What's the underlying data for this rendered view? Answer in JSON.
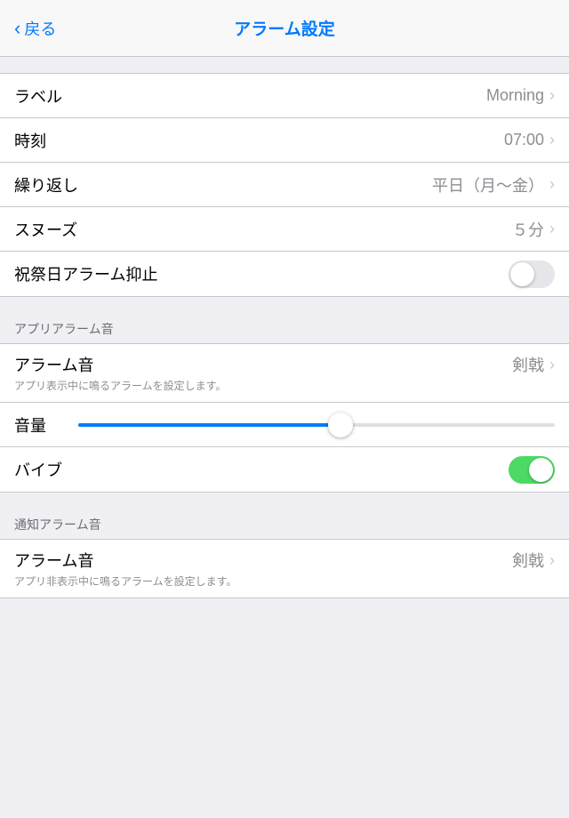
{
  "nav": {
    "back_label": "戻る",
    "title": "アラーム設定"
  },
  "sections": {
    "main": {
      "rows": [
        {
          "id": "label",
          "left": "ラベル",
          "right": "Morning",
          "has_chevron": true
        },
        {
          "id": "time",
          "left": "時刻",
          "right": "07:00",
          "has_chevron": true
        },
        {
          "id": "repeat",
          "left": "繰り返し",
          "right": "平日（月〜金）",
          "has_chevron": true
        },
        {
          "id": "snooze",
          "left": "スヌーズ",
          "right": "５分",
          "has_chevron": true
        },
        {
          "id": "holiday",
          "left": "祝祭日アラーム抑止",
          "right": null,
          "toggle": "off",
          "has_chevron": false
        }
      ]
    },
    "app_alarm": {
      "section_label": "アプリアラーム音",
      "rows": [
        {
          "id": "alarm-sound-app",
          "left": "アラーム音",
          "subtitle": "アプリ表示中に鳴るアラームを設定します。",
          "right": "剣戟",
          "has_chevron": true
        },
        {
          "id": "volume",
          "left": "音量",
          "is_slider": true,
          "fill_percent": 55
        },
        {
          "id": "vibrate",
          "left": "バイブ",
          "toggle": "on",
          "has_chevron": false
        }
      ]
    },
    "notification_alarm": {
      "section_label": "通知アラーム音",
      "rows": [
        {
          "id": "alarm-sound-notify",
          "left": "アラーム音",
          "subtitle": "アプリ非表示中に鳴るアラームを設定します。",
          "right": "剣戟",
          "has_chevron": true
        }
      ]
    }
  }
}
